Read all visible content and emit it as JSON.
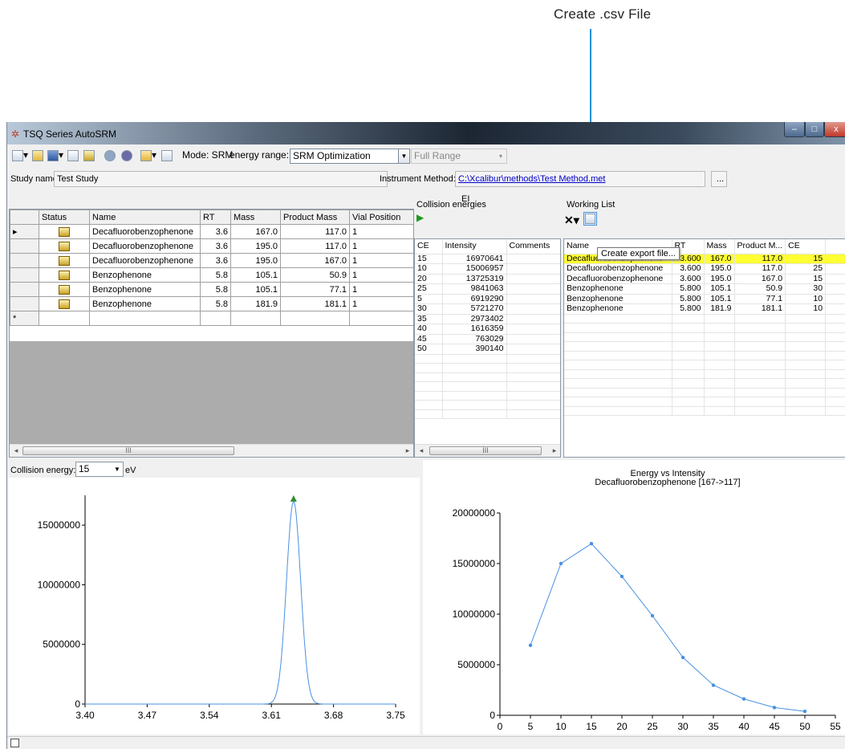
{
  "callout": {
    "label": "Create .csv File"
  },
  "window": {
    "title": "TSQ Series AutoSRM",
    "min_glyph": "–",
    "max_glyph": "□",
    "close_glyph": "x"
  },
  "toolbar": {
    "icons": [
      "new-file-icon",
      "open-folder-icon",
      "save-icon",
      "print-icon",
      "chart-icon",
      "transfer-icon",
      "settings-gear-icon",
      "report-icon",
      "export-icon"
    ],
    "mode_label": "Mode: SRM",
    "energy_range_label": "energy range:",
    "energy_range_value": "SRM Optimization",
    "range_value": "Full Range"
  },
  "study": {
    "name_label": "Study name:",
    "name_value": "Test Study"
  },
  "instrument": {
    "label": "Instrument Method:",
    "path": "C:\\Xcalibur\\methods\\Test Method.met",
    "browse_label": "...",
    "ion_mode": "EI"
  },
  "study_grid": {
    "columns": [
      "Status",
      "Name",
      "RT",
      "Mass",
      "Product Mass",
      "Vial Position"
    ],
    "rows": [
      {
        "marker": "▸",
        "name": "Decafluorobenzophenone",
        "rt": "3.6",
        "mass": "167.0",
        "product_mass": "117.0",
        "vial": "1"
      },
      {
        "marker": "",
        "name": "Decafluorobenzophenone",
        "rt": "3.6",
        "mass": "195.0",
        "product_mass": "117.0",
        "vial": "1"
      },
      {
        "marker": "",
        "name": "Decafluorobenzophenone",
        "rt": "3.6",
        "mass": "195.0",
        "product_mass": "167.0",
        "vial": "1"
      },
      {
        "marker": "",
        "name": "Benzophenone",
        "rt": "5.8",
        "mass": "105.1",
        "product_mass": "50.9",
        "vial": "1"
      },
      {
        "marker": "",
        "name": "Benzophenone",
        "rt": "5.8",
        "mass": "105.1",
        "product_mass": "77.1",
        "vial": "1"
      },
      {
        "marker": "",
        "name": "Benzophenone",
        "rt": "5.8",
        "mass": "181.9",
        "product_mass": "181.1",
        "vial": "1"
      }
    ],
    "new_row_marker": "*"
  },
  "collision_energies": {
    "title": "Collision energies",
    "columns": [
      "CE",
      "Intensity",
      "Comments"
    ],
    "rows": [
      {
        "ce": "15",
        "intensity": "16970641"
      },
      {
        "ce": "10",
        "intensity": "15006957"
      },
      {
        "ce": "20",
        "intensity": "13725319"
      },
      {
        "ce": "25",
        "intensity": "9841063"
      },
      {
        "ce": "5",
        "intensity": "6919290"
      },
      {
        "ce": "30",
        "intensity": "5721270"
      },
      {
        "ce": "35",
        "intensity": "2973402"
      },
      {
        "ce": "40",
        "intensity": "1616359"
      },
      {
        "ce": "45",
        "intensity": "763029"
      },
      {
        "ce": "50",
        "intensity": "390140"
      }
    ]
  },
  "working_list": {
    "title": "Working List",
    "columns": [
      "Name",
      "RT",
      "Mass",
      "Product M...",
      "CE"
    ],
    "rows": [
      {
        "name": "Decafluorobenzophenone",
        "rt": "3.600",
        "mass": "167.0",
        "product_mass": "117.0",
        "ce": "15",
        "highlighted": true
      },
      {
        "name": "Decafluorobenzophenone",
        "rt": "3.600",
        "mass": "195.0",
        "product_mass": "117.0",
        "ce": "25"
      },
      {
        "name": "Decafluorobenzophenone",
        "rt": "3.600",
        "mass": "195.0",
        "product_mass": "167.0",
        "ce": "15"
      },
      {
        "name": "Benzophenone",
        "rt": "5.800",
        "mass": "105.1",
        "product_mass": "50.9",
        "ce": "30"
      },
      {
        "name": "Benzophenone",
        "rt": "5.800",
        "mass": "105.1",
        "product_mass": "77.1",
        "ce": "10"
      },
      {
        "name": "Benzophenone",
        "rt": "5.800",
        "mass": "181.9",
        "product_mass": "181.1",
        "ce": "10"
      }
    ],
    "tooltip": "Create export file...",
    "highlight_color": "#ffff33"
  },
  "collision_energy_selector": {
    "label": "Collision energy:",
    "value": "15",
    "unit": "eV"
  },
  "scrollbars": {
    "left": "◂",
    "right": "▸",
    "thumb": "III"
  },
  "chart_data": [
    {
      "type": "line",
      "title": "",
      "xlabel": "",
      "ylabel": "",
      "xlim": [
        3.4,
        3.75
      ],
      "ylim": [
        0,
        17500000
      ],
      "x_ticks": [
        "3.40",
        "3.47",
        "3.54",
        "3.61",
        "3.68",
        "3.75"
      ],
      "y_ticks": [
        "0",
        "5000000",
        "10000000",
        "15000000"
      ],
      "peak": {
        "x": 3.635,
        "y": 16970641,
        "width": 0.008
      },
      "series": [
        {
          "color": "#4a90e2"
        }
      ],
      "peak_marker_color": "#2e8b2e",
      "grid": false
    },
    {
      "type": "line",
      "title": "Energy vs Intensity",
      "subtitle": "Decafluorobenzophenone [167->117]",
      "xlabel": "",
      "ylabel": "",
      "xlim": [
        0,
        55
      ],
      "ylim": [
        0,
        20000000
      ],
      "x_ticks": [
        "0",
        "5",
        "10",
        "15",
        "20",
        "25",
        "30",
        "35",
        "40",
        "45",
        "50",
        "55"
      ],
      "y_ticks": [
        "0",
        "5000000",
        "10000000",
        "15000000",
        "20000000"
      ],
      "x": [
        5,
        10,
        15,
        20,
        25,
        30,
        35,
        40,
        45,
        50
      ],
      "series": [
        {
          "values": [
            6919290,
            15006957,
            16970641,
            13725319,
            9841063,
            5721270,
            2973402,
            1616359,
            763029,
            390140
          ],
          "color": "#4a90e2"
        }
      ],
      "grid": false
    }
  ],
  "statusbar": {
    "icon": "status-icon"
  }
}
